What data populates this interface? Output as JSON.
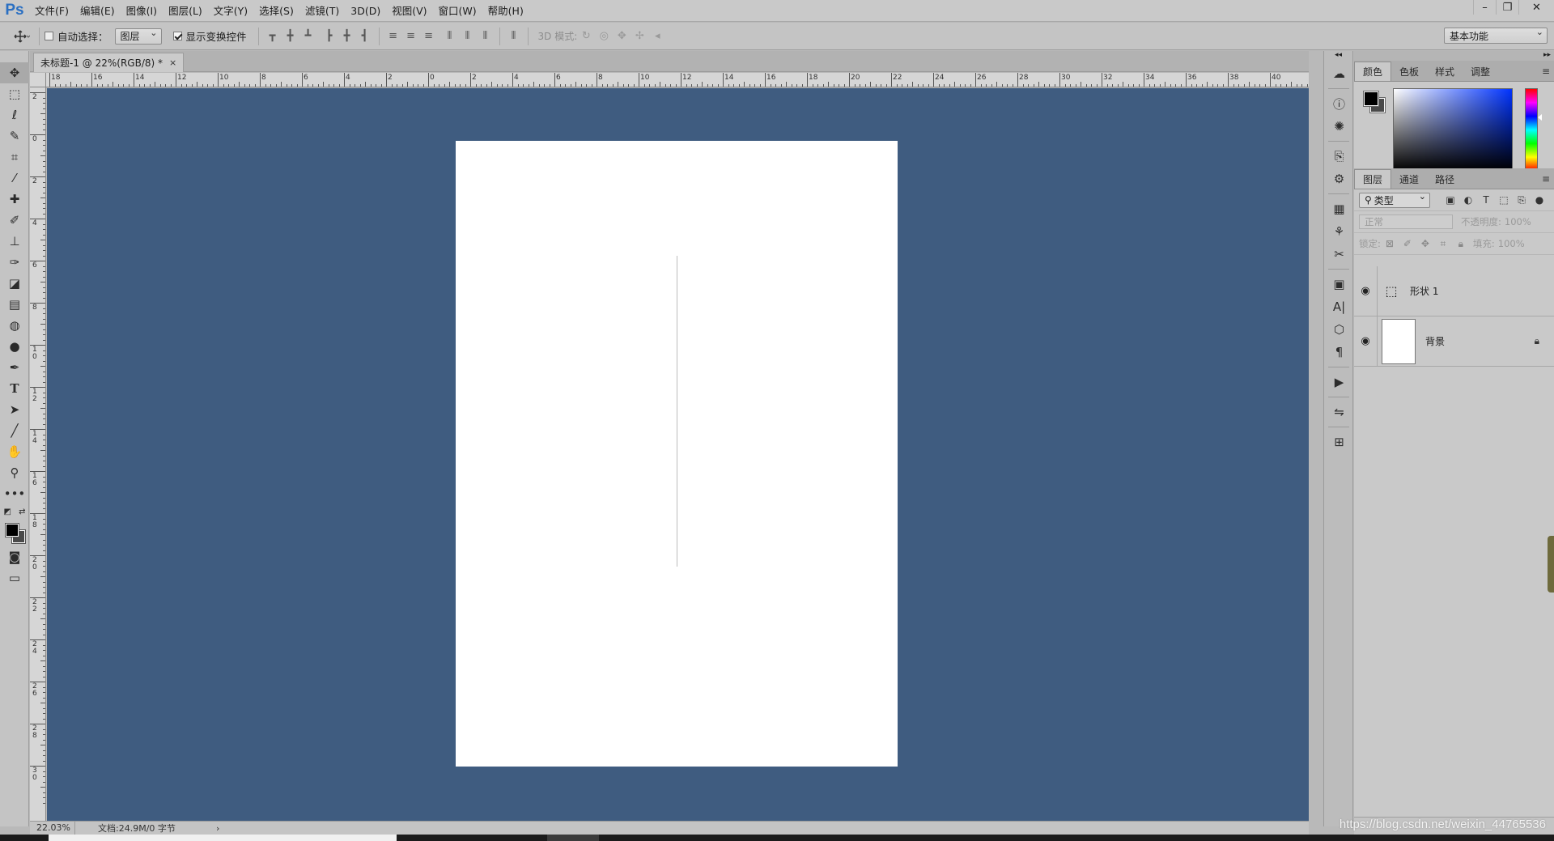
{
  "app": {
    "logo": "Ps"
  },
  "menubar": {
    "items": [
      "文件(F)",
      "编辑(E)",
      "图像(I)",
      "图层(L)",
      "文字(Y)",
      "选择(S)",
      "滤镜(T)",
      "3D(D)",
      "视图(V)",
      "窗口(W)",
      "帮助(H)"
    ],
    "window_controls": {
      "minimize": "–",
      "restore": "❐",
      "close": "✕"
    }
  },
  "options": {
    "auto_select_label": "自动选择：",
    "auto_select_checked": false,
    "auto_select_value": "图层",
    "show_transform_label": "显示变换控件",
    "show_transform_checked": true,
    "mode_3d_label": "3D 模式:",
    "workspace": "基本功能"
  },
  "document": {
    "tab_title": "未标题-1 @ 22%(RGB/8) *",
    "tab_close": "×"
  },
  "ruler": {
    "top_labels": [
      "18",
      "16",
      "14",
      "12",
      "10",
      "8",
      "6",
      "4",
      "2",
      "0",
      "2",
      "4",
      "6",
      "8",
      "10",
      "12",
      "14",
      "16",
      "18",
      "20",
      "22",
      "24",
      "26",
      "28",
      "30",
      "32",
      "34",
      "36",
      "38",
      "40"
    ],
    "left_labels": [
      "2",
      "0",
      "2",
      "4",
      "6",
      "8",
      "10",
      "12",
      "14",
      "16",
      "18",
      "20",
      "22",
      "24",
      "26",
      "28",
      "30"
    ]
  },
  "status": {
    "zoom": "22.03%",
    "doc_info": "文档:24.9M/0 字节",
    "arrow": "›"
  },
  "panels": {
    "color_tabs": [
      "颜色",
      "色板",
      "样式",
      "调整"
    ],
    "layer_tabs": [
      "图层",
      "通道",
      "路径"
    ],
    "filter_kind": "类型",
    "blend_mode": "正常",
    "opacity_label": "不透明度:",
    "opacity_value": "100%",
    "lock_label": "锁定:",
    "fill_label": "填充:",
    "fill_value": "100%",
    "layers": [
      {
        "name": "形状 1",
        "type": "shape",
        "visible": true,
        "locked": false
      },
      {
        "name": "背景",
        "type": "background",
        "visible": true,
        "locked": true
      }
    ]
  },
  "colors": {
    "canvas_bg": "#3f5c80",
    "foreground": "#000000",
    "background": "#4a4a4a"
  },
  "watermark": "https://blog.csdn.net/weixin_44765536"
}
